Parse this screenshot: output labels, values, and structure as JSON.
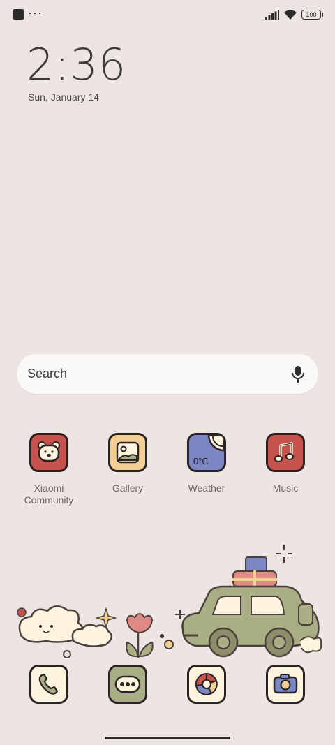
{
  "status_bar": {
    "more": "···",
    "battery": "100"
  },
  "lockscreen": {
    "time": "2:36",
    "date": "Sun, January 14"
  },
  "search": {
    "label": "Search"
  },
  "apps": [
    {
      "name": "Xiaomi Community",
      "icon": "bear-face-icon",
      "color": "#c6544d"
    },
    {
      "name": "Gallery",
      "icon": "picture-icon",
      "color": "#f3cf93"
    },
    {
      "name": "Weather",
      "icon": "weather-icon",
      "color": "#7c86c2",
      "temp": "0°C"
    },
    {
      "name": "Music",
      "icon": "music-note-icon",
      "color": "#c6544d"
    }
  ],
  "dock": [
    {
      "icon": "phone-icon",
      "color": "#fff4dd"
    },
    {
      "icon": "messages-icon",
      "color": "#a9ae84"
    },
    {
      "icon": "browser-icon",
      "color": "#fff4dd"
    },
    {
      "icon": "camera-icon",
      "color": "#fff4dd"
    }
  ]
}
